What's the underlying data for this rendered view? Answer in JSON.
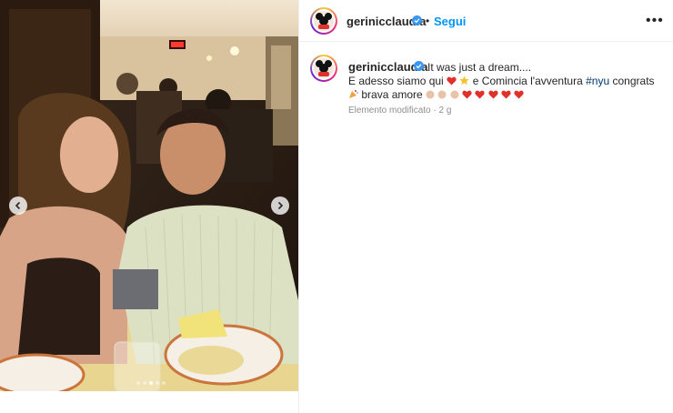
{
  "post": {
    "username": "gerinicclaudia",
    "follow_label": "Segui",
    "separator": "•",
    "more_label": "•••"
  },
  "caption": {
    "username": "gerinicclaudia",
    "line1_text": "It was just a dream....",
    "line2_part1": "E adesso siamo qui",
    "line2_part2": "e Comincia l'avventura",
    "line2_hashtag": "#nyu",
    "line2_part3": "congrats",
    "line3_text": "brava amore",
    "meta": "Elemento modificato · 2 g"
  },
  "carousel": {
    "slide_count": 5,
    "active_slide": 3
  },
  "colors": {
    "follow": "#0095f6",
    "verified": "#3897f0",
    "hashtag": "#00376b",
    "heart": "#e0322b"
  },
  "icons": {
    "verified": "verified-badge-icon",
    "more": "more-options-icon",
    "prev": "chevron-left-icon",
    "next": "chevron-right-icon",
    "heart": "red-heart-emoji",
    "star": "star-emoji",
    "clap": "clapping-hands-emoji",
    "party": "party-popper-emoji"
  }
}
